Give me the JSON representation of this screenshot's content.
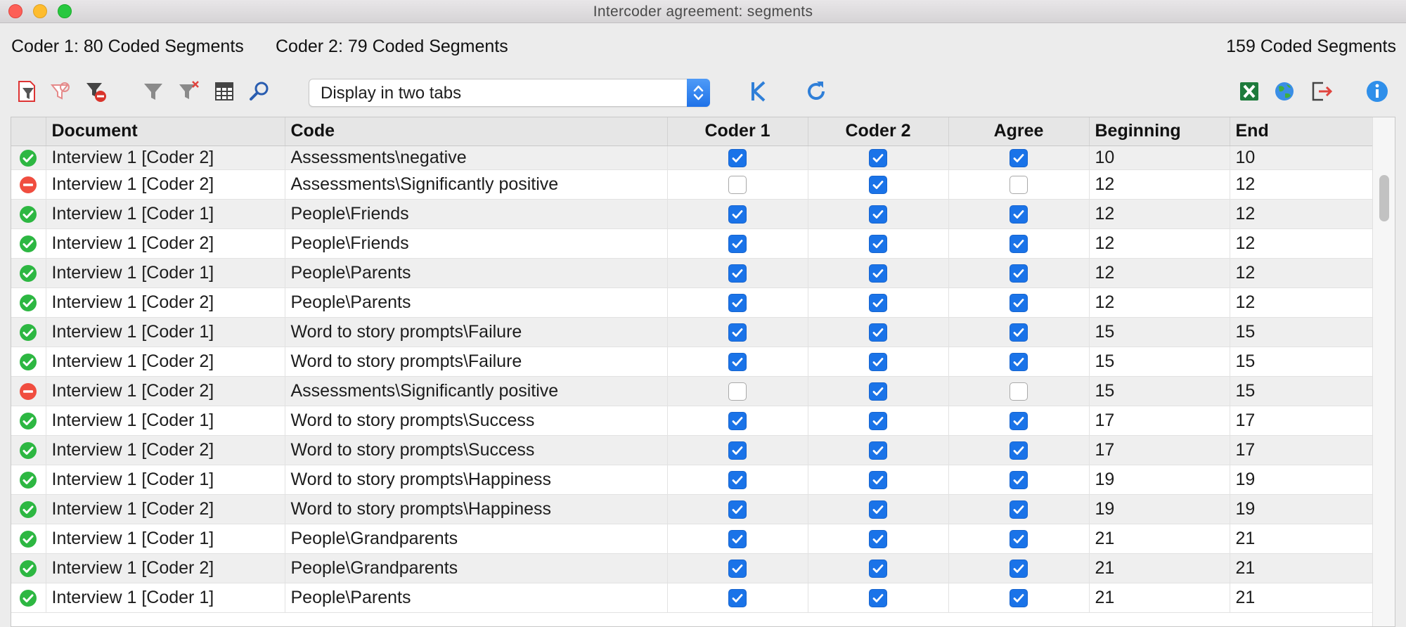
{
  "window": {
    "title": "Intercoder agreement: segments"
  },
  "summary": {
    "coder1": "Coder 1: 80 Coded Segments",
    "coder2": "Coder 2: 79 Coded Segments",
    "total": "159 Coded Segments"
  },
  "toolbar": {
    "display_mode": "Display in two tabs",
    "icons": [
      "activate-filter-icon",
      "filter-coded-icon",
      "remove-filter-icon",
      "filter-icon",
      "clear-filter-icon",
      "columns-icon",
      "search-icon",
      "kappa-icon",
      "refresh-icon",
      "excel-export-icon",
      "web-export-icon",
      "export-icon",
      "info-icon"
    ]
  },
  "colors": {
    "agree": "#2db742",
    "disagree": "#f04d3f",
    "checkbox": "#1a73e8"
  },
  "table": {
    "columns": [
      "Document",
      "Code",
      "Coder 1",
      "Coder 2",
      "Agree",
      "Beginning",
      "End"
    ],
    "rows": [
      {
        "status": "agree",
        "document": "Interview 1 [Coder 2]",
        "code": "Assessments\\negative",
        "coder1": true,
        "coder2": true,
        "agree": true,
        "beginning": "10",
        "end": "10"
      },
      {
        "status": "disagree",
        "document": "Interview 1 [Coder 2]",
        "code": "Assessments\\Significantly positive",
        "coder1": false,
        "coder2": true,
        "agree": false,
        "beginning": "12",
        "end": "12"
      },
      {
        "status": "agree",
        "document": "Interview 1 [Coder 1]",
        "code": "People\\Friends",
        "coder1": true,
        "coder2": true,
        "agree": true,
        "beginning": "12",
        "end": "12"
      },
      {
        "status": "agree",
        "document": "Interview 1 [Coder 2]",
        "code": "People\\Friends",
        "coder1": true,
        "coder2": true,
        "agree": true,
        "beginning": "12",
        "end": "12"
      },
      {
        "status": "agree",
        "document": "Interview 1 [Coder 1]",
        "code": "People\\Parents",
        "coder1": true,
        "coder2": true,
        "agree": true,
        "beginning": "12",
        "end": "12"
      },
      {
        "status": "agree",
        "document": "Interview 1 [Coder 2]",
        "code": "People\\Parents",
        "coder1": true,
        "coder2": true,
        "agree": true,
        "beginning": "12",
        "end": "12"
      },
      {
        "status": "agree",
        "document": "Interview 1 [Coder 1]",
        "code": "Word to story prompts\\Failure",
        "coder1": true,
        "coder2": true,
        "agree": true,
        "beginning": "15",
        "end": "15"
      },
      {
        "status": "agree",
        "document": "Interview 1 [Coder 2]",
        "code": "Word to story prompts\\Failure",
        "coder1": true,
        "coder2": true,
        "agree": true,
        "beginning": "15",
        "end": "15"
      },
      {
        "status": "disagree",
        "document": "Interview 1 [Coder 2]",
        "code": "Assessments\\Significantly positive",
        "coder1": false,
        "coder2": true,
        "agree": false,
        "beginning": "15",
        "end": "15"
      },
      {
        "status": "agree",
        "document": "Interview 1 [Coder 1]",
        "code": "Word to story prompts\\Success",
        "coder1": true,
        "coder2": true,
        "agree": true,
        "beginning": "17",
        "end": "17"
      },
      {
        "status": "agree",
        "document": "Interview 1 [Coder 2]",
        "code": "Word to story prompts\\Success",
        "coder1": true,
        "coder2": true,
        "agree": true,
        "beginning": "17",
        "end": "17"
      },
      {
        "status": "agree",
        "document": "Interview 1 [Coder 1]",
        "code": "Word to story prompts\\Happiness",
        "coder1": true,
        "coder2": true,
        "agree": true,
        "beginning": "19",
        "end": "19"
      },
      {
        "status": "agree",
        "document": "Interview 1 [Coder 2]",
        "code": "Word to story prompts\\Happiness",
        "coder1": true,
        "coder2": true,
        "agree": true,
        "beginning": "19",
        "end": "19"
      },
      {
        "status": "agree",
        "document": "Interview 1 [Coder 1]",
        "code": "People\\Grandparents",
        "coder1": true,
        "coder2": true,
        "agree": true,
        "beginning": "21",
        "end": "21"
      },
      {
        "status": "agree",
        "document": "Interview 1 [Coder 2]",
        "code": "People\\Grandparents",
        "coder1": true,
        "coder2": true,
        "agree": true,
        "beginning": "21",
        "end": "21"
      },
      {
        "status": "agree",
        "document": "Interview 1 [Coder 1]",
        "code": "People\\Parents",
        "coder1": true,
        "coder2": true,
        "agree": true,
        "beginning": "21",
        "end": "21"
      }
    ]
  }
}
